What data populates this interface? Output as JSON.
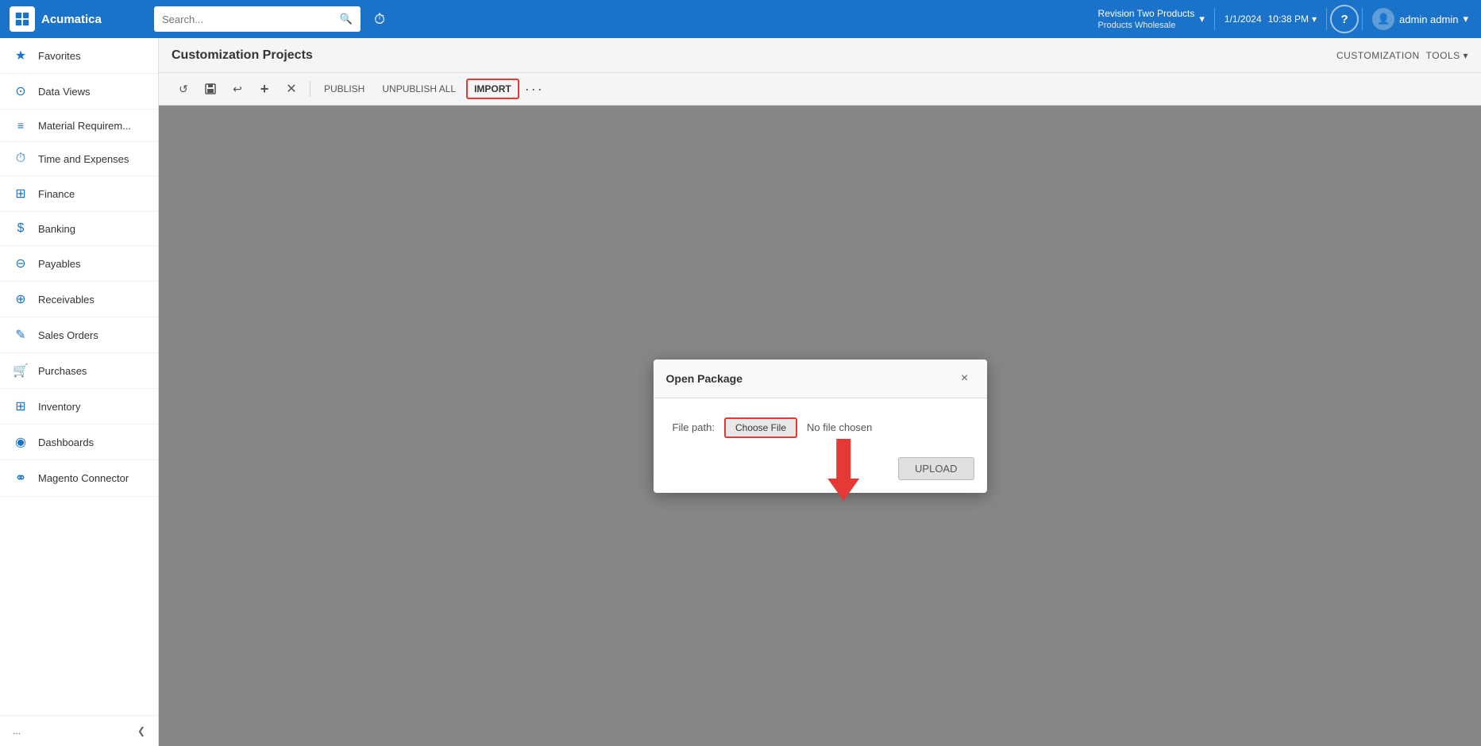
{
  "app": {
    "name": "Acumatica"
  },
  "topnav": {
    "search_placeholder": "Search...",
    "branch": {
      "name": "Revision Two Products",
      "sub": "Products Wholesale"
    },
    "date": "1/1/2024",
    "time": "10:38 PM",
    "help_label": "?",
    "user_label": "admin admin"
  },
  "sidebar": {
    "items": [
      {
        "id": "favorites",
        "label": "Favorites",
        "icon": "★"
      },
      {
        "id": "data-views",
        "label": "Data Views",
        "icon": "⊙"
      },
      {
        "id": "material-req",
        "label": "Material Requirem...",
        "icon": "≡"
      },
      {
        "id": "time-expenses",
        "label": "Time and Expenses",
        "icon": "⏱"
      },
      {
        "id": "finance",
        "label": "Finance",
        "icon": "⊞"
      },
      {
        "id": "banking",
        "label": "Banking",
        "icon": "$"
      },
      {
        "id": "payables",
        "label": "Payables",
        "icon": "⊖"
      },
      {
        "id": "receivables",
        "label": "Receivables",
        "icon": "⊕"
      },
      {
        "id": "sales-orders",
        "label": "Sales Orders",
        "icon": "✎"
      },
      {
        "id": "purchases",
        "label": "Purchases",
        "icon": "🛒"
      },
      {
        "id": "inventory",
        "label": "Inventory",
        "icon": "⊞"
      },
      {
        "id": "dashboards",
        "label": "Dashboards",
        "icon": "◉"
      },
      {
        "id": "magento",
        "label": "Magento Connector",
        "icon": "⚭"
      }
    ],
    "footer": {
      "more_label": "...",
      "collapse_label": "❮"
    }
  },
  "page": {
    "title": "Customization Projects",
    "header_links": [
      "CUSTOMIZATION",
      "TOOLS ▾"
    ]
  },
  "toolbar": {
    "buttons": [
      {
        "id": "refresh",
        "icon": "↺",
        "label": ""
      },
      {
        "id": "save",
        "icon": "💾",
        "label": ""
      },
      {
        "id": "undo",
        "icon": "↩",
        "label": ""
      },
      {
        "id": "add",
        "icon": "+",
        "label": ""
      },
      {
        "id": "delete",
        "icon": "✕",
        "label": ""
      },
      {
        "id": "publish",
        "label": "PUBLISH"
      },
      {
        "id": "unpublish-all",
        "label": "UNPUBLISH ALL"
      },
      {
        "id": "import",
        "label": "IMPORT"
      },
      {
        "id": "more",
        "icon": "···",
        "label": ""
      }
    ]
  },
  "modal": {
    "title": "Open Package",
    "file_path_label": "File path:",
    "choose_file_label": "Choose File",
    "no_file_text": "No file chosen",
    "upload_label": "UPLOAD",
    "close_icon": "×"
  }
}
